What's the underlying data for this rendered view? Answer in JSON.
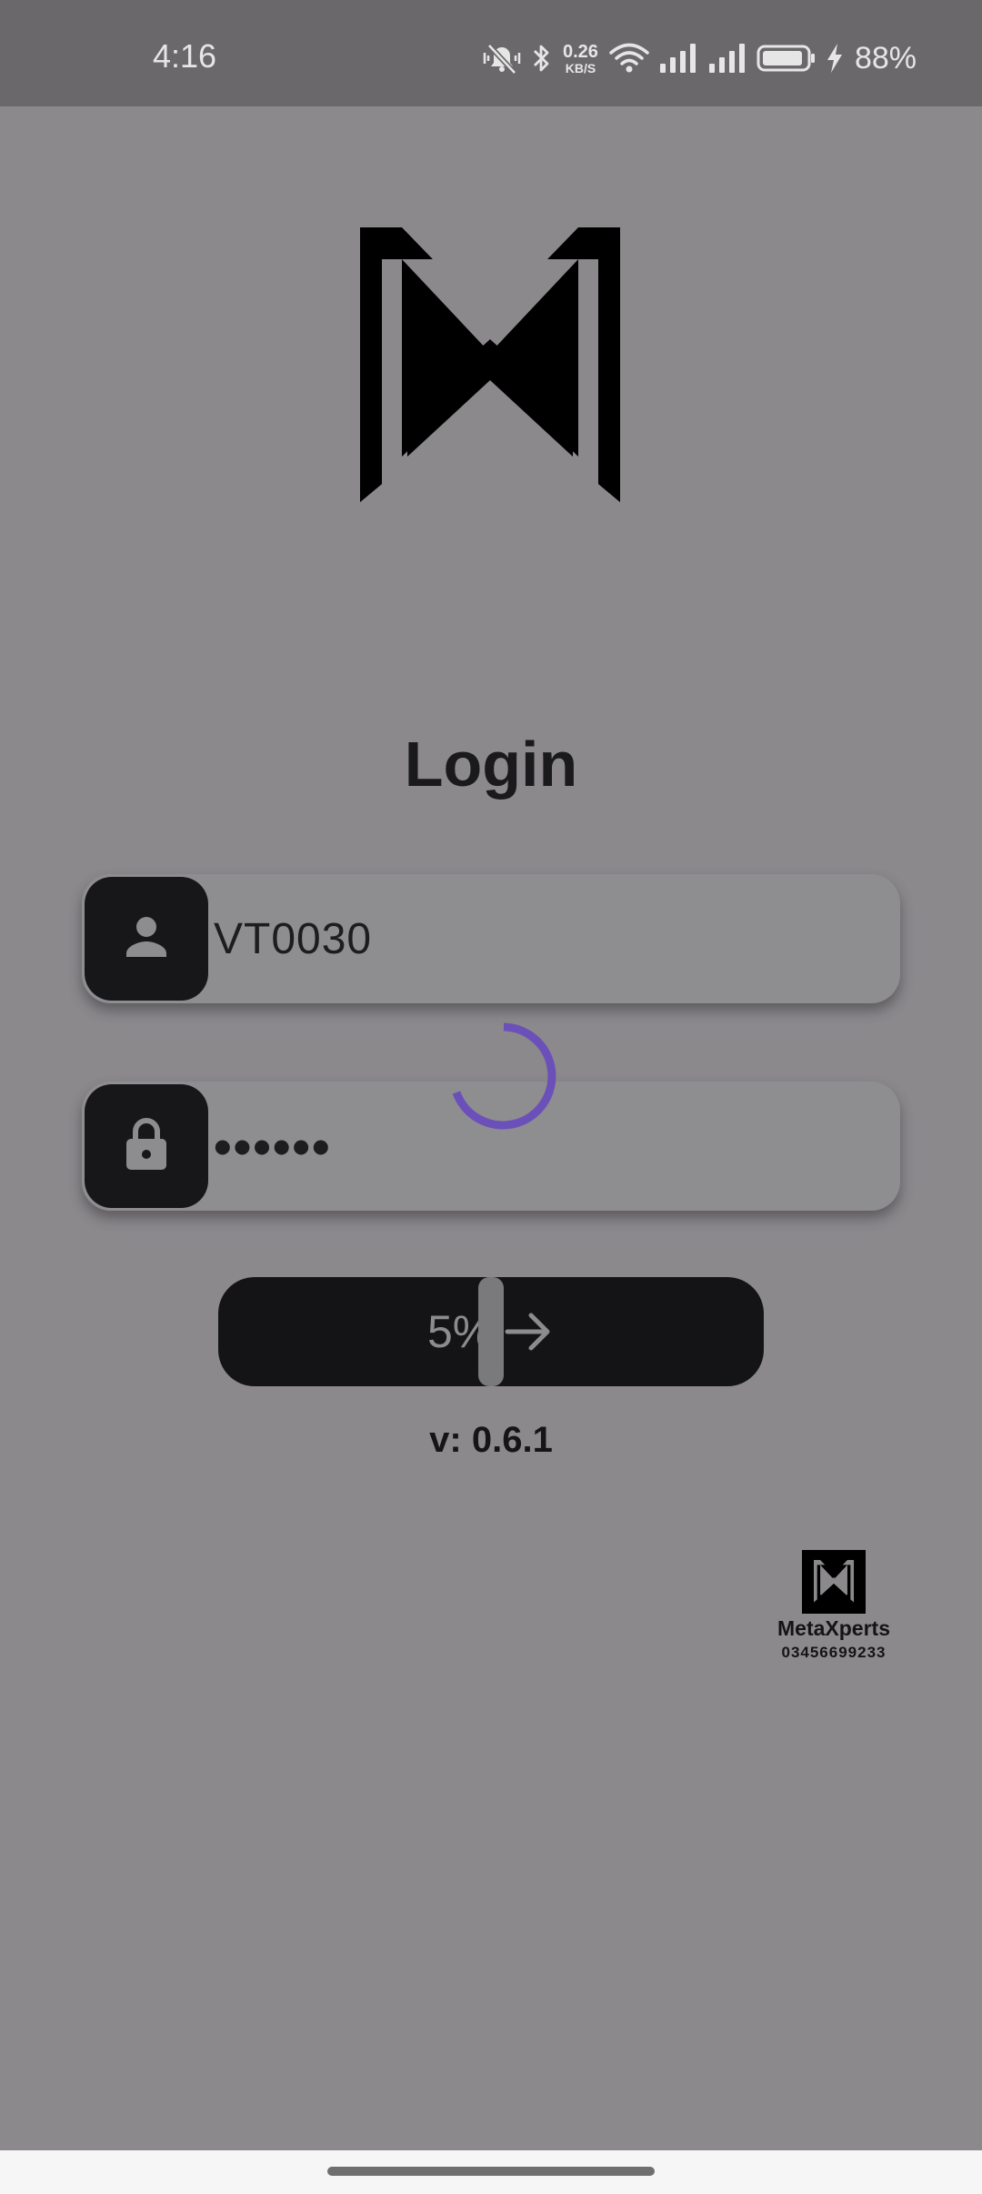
{
  "status_bar": {
    "time": "4:16",
    "net_speed_value": "0.26",
    "net_speed_unit": "KB/S",
    "battery_percent": "88%",
    "icons": [
      "mute-vibrate-icon",
      "bluetooth-icon",
      "wifi-icon",
      "signal-icon",
      "signal-icon",
      "battery-icon",
      "charging-icon"
    ]
  },
  "login": {
    "title": "Login",
    "username_value": "VT0030",
    "password_value": "••••••",
    "username_icon": "person-icon",
    "password_icon": "lock-icon",
    "submit_progress_text": "5%",
    "submit_progress": 0.05,
    "submit_icon": "arrow-right-icon",
    "loading_icon": "loading-spinner-icon",
    "version": "v: 0.6.1"
  },
  "branding": {
    "company_name": "MetaXperts",
    "company_phone": "03456699233"
  },
  "colors": {
    "background": "#8b898c",
    "status_bar": "#6a686b",
    "field": "#8e8d8f",
    "dark": "#17171a",
    "spinner": "#6b50b9"
  }
}
